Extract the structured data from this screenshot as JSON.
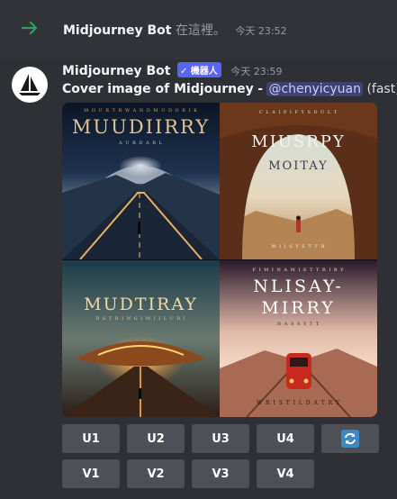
{
  "system_message": {
    "bot_name": "Midjourney Bot",
    "text": "在這裡。",
    "timestamp": "今天 23:52"
  },
  "message": {
    "author": "Midjourney Bot",
    "badge": "✓ 機器人",
    "timestamp": "今天 23:59",
    "prompt": "Cover image of Midjourney",
    "separator": "-",
    "mention": "@chenyicyuan",
    "mode": "(fast)"
  },
  "images": [
    {
      "title": "MUUDIIRRY",
      "small_top": "M O U R T R W A N D  M U D O R I K",
      "small_bottom": "A U R D A R L"
    },
    {
      "title": "MIUSRPY",
      "title2": "MOITAY",
      "small_top": "C L A  I P I F Y S D U L T",
      "small_bottom": "M I I S Y E T T H"
    },
    {
      "title": "MUDTIRAY",
      "small_top": "",
      "small_bottom": "D  S T R I N G I M I I L U R I"
    },
    {
      "title": "NLISAY-",
      "title2": "MIRRY",
      "small_top": "F I M I N A M I E T  T R I B Y",
      "small_bottom": "W R I S T I L D A T R Y",
      "sub": "N A S S Y T T"
    }
  ],
  "buttons": {
    "row1": [
      "U1",
      "U2",
      "U3",
      "U4"
    ],
    "row2": [
      "V1",
      "V2",
      "V3",
      "V4"
    ],
    "reroll_icon": "refresh-icon"
  },
  "colors": {
    "background": "#313338",
    "button": "#4e5058",
    "accent_green": "#23a55a",
    "badge": "#5865f2",
    "mention_bg": "#3e4270"
  }
}
